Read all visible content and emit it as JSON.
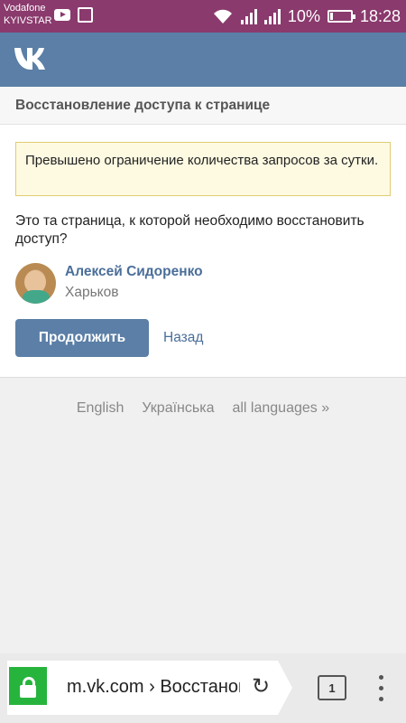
{
  "status_bar": {
    "carrier_line1": "Vodafone",
    "carrier_line2": "KYIVSTAR",
    "battery_percent": "10%",
    "time": "18:28"
  },
  "header": {
    "logo_icon": "vk-logo"
  },
  "page": {
    "title": "Восстановление доступа к странице",
    "warning": "Превышено ограничение количества запросов за сутки.",
    "question": "Это та страница, к которой необходимо восстановить доступ?",
    "user": {
      "name": "Алексей Сидоренко",
      "city": "Харьков"
    },
    "continue_label": "Продолжить",
    "back_label": "Назад"
  },
  "languages": [
    "English",
    "Українська",
    "all languages »"
  ],
  "browser": {
    "url": "m.vk.com › Восстановление",
    "tabs_count": "1"
  },
  "colors": {
    "status_bar": "#8a3a6d",
    "vk_blue": "#5b7fa6",
    "link": "#4a6e99",
    "warning_bg": "#fefae2",
    "secure_green": "#27b43d"
  }
}
